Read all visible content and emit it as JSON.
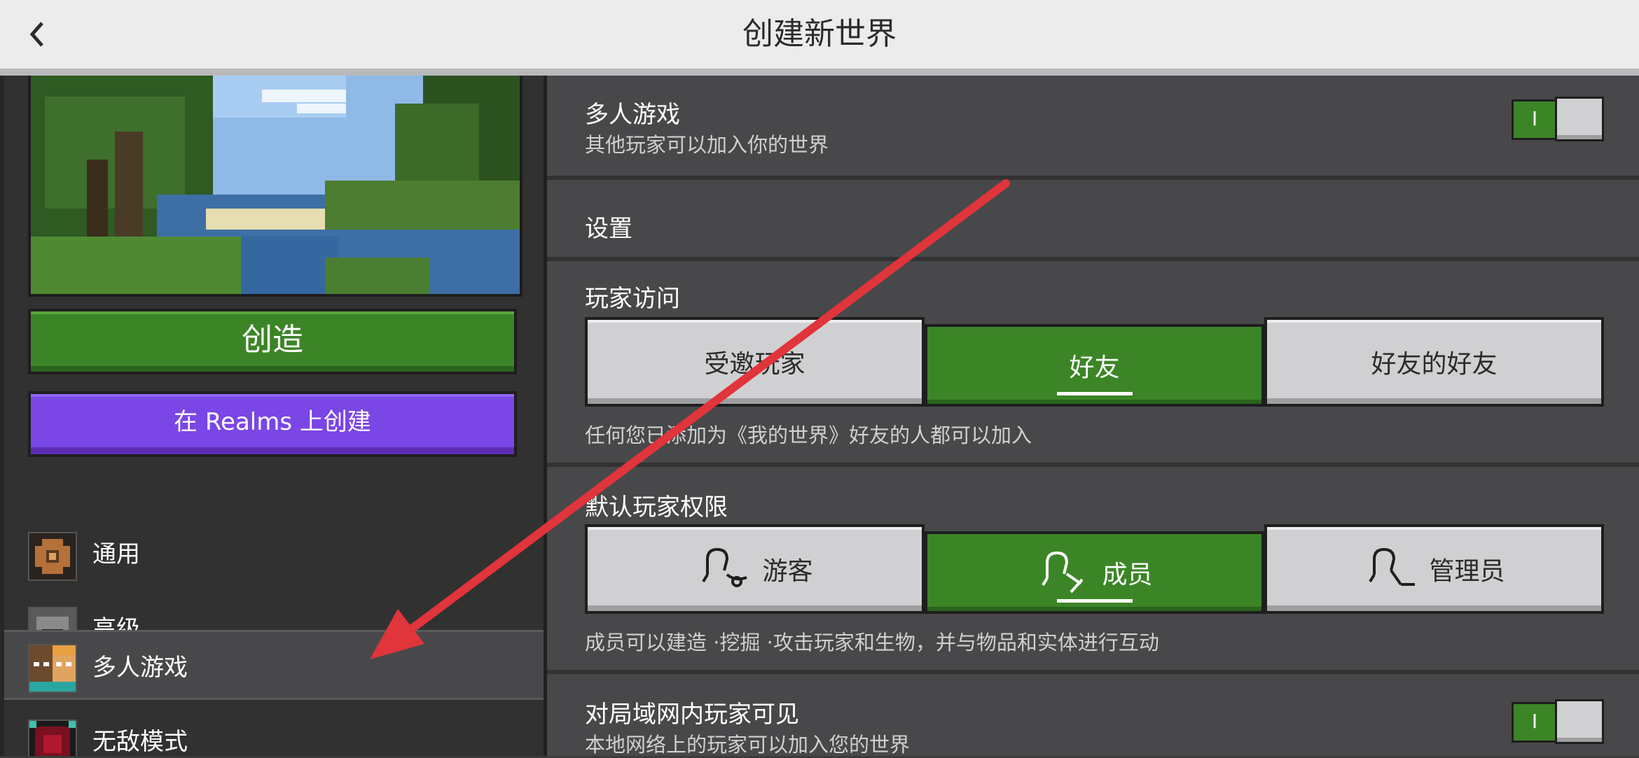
{
  "header": {
    "title": "创建新世界",
    "back_icon": "chevron-left-icon"
  },
  "left": {
    "create_label": "创造",
    "realms_label": "在 Realms 上创建",
    "nav": [
      {
        "label": "通用",
        "icon": "gear-icon"
      },
      {
        "label": "高级",
        "icon": "furnace-icon"
      },
      {
        "label": "多人游戏",
        "icon": "players-icon",
        "active": true
      },
      {
        "label": "无敌模式",
        "icon": "cheats-icon"
      }
    ]
  },
  "multiplayer": {
    "title": "多人游戏",
    "subtitle": "其他玩家可以加入你的世界",
    "toggle_text": "I",
    "enabled": true
  },
  "settings": {
    "title": "设置"
  },
  "player_access": {
    "title": "玩家访问",
    "options": [
      "受邀玩家",
      "好友",
      "好友的好友"
    ],
    "selected": "好友",
    "hint": "任何您已添加为《我的世界》好友的人都可以加入"
  },
  "default_permission": {
    "title": "默认玩家权限",
    "options": [
      "游客",
      "成员",
      "管理员"
    ],
    "selected": "成员",
    "hint": "成员可以建造 ·挖掘 ·攻击玩家和生物，并与物品和实体进行互动"
  },
  "lan": {
    "title": "对局域网内玩家可见",
    "subtitle": "本地网络上的玩家可以加入您的世界",
    "toggle_text": "I",
    "enabled": true
  },
  "colors": {
    "accent_green": "#3c8527",
    "realms_purple": "#7a46e6",
    "annotation_arrow": "#e0353a"
  }
}
